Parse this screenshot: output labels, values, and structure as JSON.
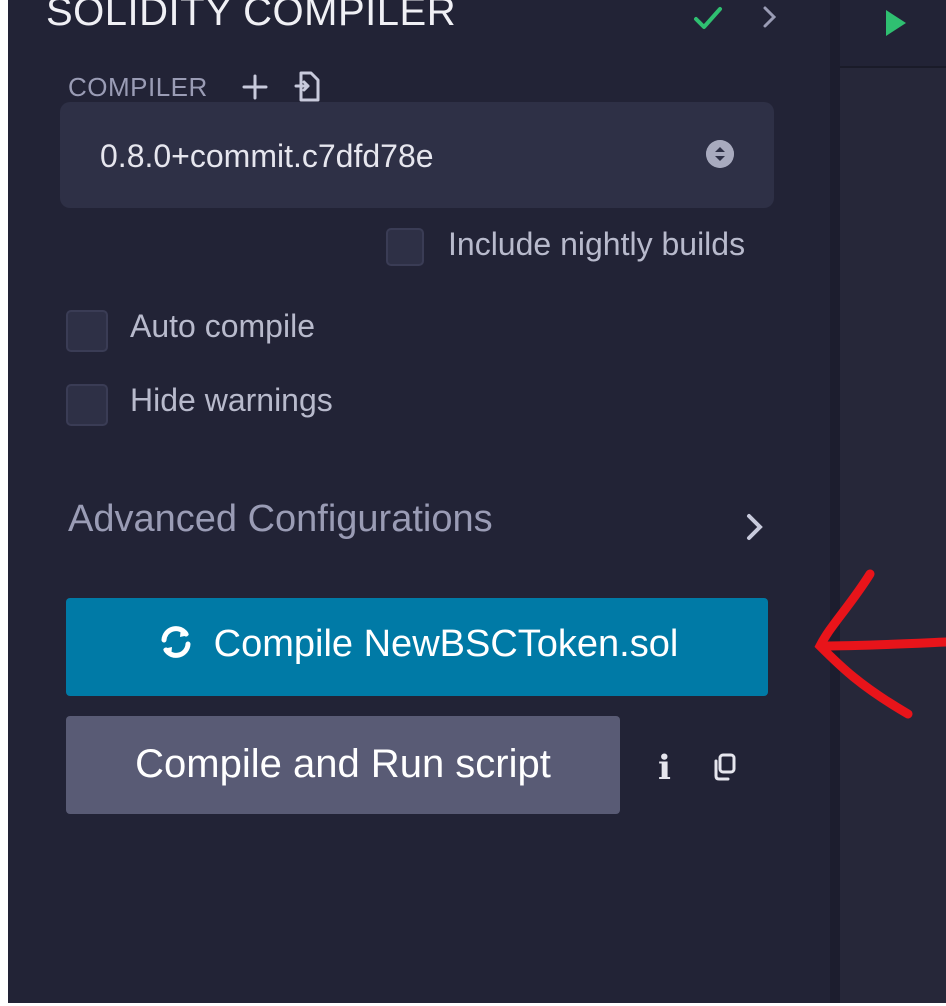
{
  "panel": {
    "title": "SOLIDITY COMPILER",
    "compiler_label": "COMPILER",
    "compiler_version": "0.8.0+commit.c7dfd78e",
    "include_nightly_label": "Include nightly builds",
    "auto_compile_label": "Auto compile",
    "hide_warnings_label": "Hide warnings",
    "advanced_label": "Advanced Configurations",
    "compile_button_label": "Compile NewBSCToken.sol",
    "compile_run_button_label": "Compile and Run script",
    "info_label": "i"
  },
  "checkboxes": {
    "include_nightly": false,
    "auto_compile": false,
    "hide_warnings": false
  },
  "icons": {
    "status": "check-icon",
    "collapse": "chevron-right-icon",
    "add_compiler": "plus-icon",
    "load_file": "file-icon",
    "select_arrows": "select-arrows-icon",
    "advanced_toggle": "chevron-right-icon",
    "compile": "sync-icon",
    "info": "info-icon",
    "copy": "copy-icon",
    "run": "play-icon"
  },
  "colors": {
    "panel_bg": "#222336",
    "primary_button": "#007aa6",
    "secondary_button": "#595b75",
    "success_check": "#2fbf71",
    "annotation": "#e8141a"
  }
}
